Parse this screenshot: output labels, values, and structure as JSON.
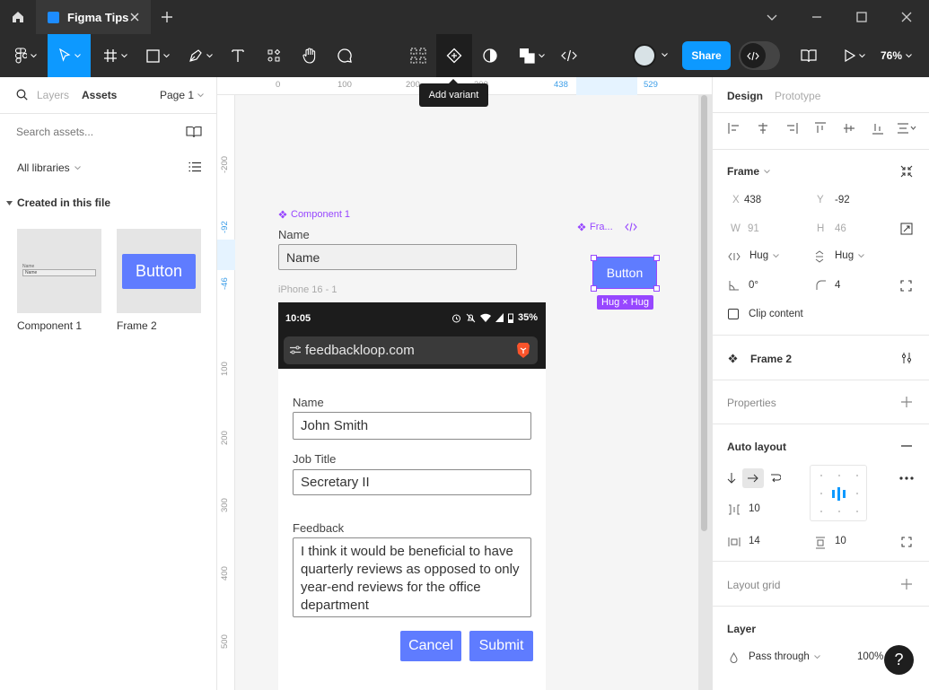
{
  "window": {
    "tab_title": "Figma Tips",
    "tooltip": "Add variant"
  },
  "toolbar": {
    "share_label": "Share",
    "zoom": "76%"
  },
  "left_panel": {
    "tabs": [
      "Layers",
      "Assets"
    ],
    "active_tab": "Assets",
    "page_selector": "Page 1",
    "search_placeholder": "Search assets...",
    "libraries_label": "All libraries",
    "section_title": "Created in this file",
    "assets": [
      {
        "name": "Component 1",
        "preview_label": "Name",
        "preview_value": "Name"
      },
      {
        "name": "Frame 2",
        "preview_button": "Button"
      }
    ]
  },
  "canvas": {
    "ruler_top": [
      "0",
      "100",
      "200",
      "300",
      "438",
      "529"
    ],
    "ruler_left": [
      "-200",
      "-92",
      "-46",
      "100",
      "200",
      "300",
      "400",
      "500"
    ],
    "component_label": "Component 1",
    "component_field_label": "Name",
    "component_field_value": "Name",
    "frame_label": "Fra...",
    "frame_button": "Button",
    "hug_badge": "Hug × Hug",
    "phone_frame_label": "iPhone 16 - 1",
    "phone": {
      "time": "10:05",
      "battery": "35%",
      "url": "feedbackloop.com",
      "name_label": "Name",
      "name_value": "John Smith",
      "job_label": "Job Title",
      "job_value": "Secretary II",
      "feedback_label": "Feedback",
      "feedback_value": "I think it would be beneficial to have quarterly reviews as opposed to only year-end reviews for the office department",
      "cancel_label": "Cancel",
      "submit_label": "Submit"
    }
  },
  "right_panel": {
    "tabs": [
      "Design",
      "Prototype"
    ],
    "active_tab": "Design",
    "frame": {
      "title": "Frame",
      "x_label": "X",
      "x_value": "438",
      "y_label": "Y",
      "y_value": "-92",
      "w_label": "W",
      "w_value": "91",
      "h_label": "H",
      "h_value": "46",
      "width_mode": "Hug",
      "height_mode": "Hug",
      "rotation": "0°",
      "radius": "4",
      "clip_label": "Clip content"
    },
    "component_name": "Frame 2",
    "properties_title": "Properties",
    "auto_layout": {
      "title": "Auto layout",
      "gap": "10",
      "padding_h": "14",
      "padding_v": "10"
    },
    "layout_grid_title": "Layout grid",
    "layer": {
      "title": "Layer",
      "blend": "Pass through",
      "opacity": "100%"
    }
  },
  "colors": {
    "accent": "#0d99ff",
    "component": "#9747ff",
    "button": "#5f7cff",
    "toolbar_bg": "#2c2c2c"
  }
}
